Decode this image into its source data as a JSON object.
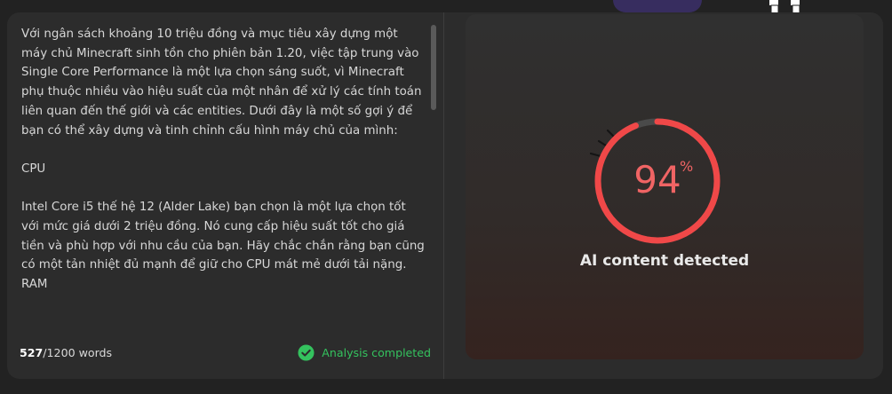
{
  "input_text": {
    "paragraphs": [
      "Với ngân sách khoảng 10 triệu đồng và mục tiêu xây dựng một máy chủ Minecraft sinh tồn cho phiên bản 1.20, việc tập trung vào Single Core Performance là một lựa chọn sáng suốt, vì Minecraft phụ thuộc nhiều vào hiệu suất của một nhân để xử lý các tính toán liên quan đến thế giới và các entities. Dưới đây là một số gợi ý để bạn có thể xây dựng và tinh chỉnh cấu hình máy chủ của mình:",
      "CPU",
      "Intel Core i5 thế hệ 12 (Alder Lake) bạn chọn là một lựa chọn tốt với mức giá dưới 2 triệu đồng. Nó cung cấp hiệu suất tốt cho giá tiền và phù hợp với nhu cầu của bạn. Hãy chắc chắn rằng bạn cũng có một tản nhiệt đủ mạnh để giữ cho CPU mát mẻ dưới tải nặng.",
      "RAM"
    ]
  },
  "word_count": {
    "current": "527",
    "limit_text": "/1200 words"
  },
  "status": {
    "label": "Analysis completed",
    "icon": "check-circle-icon",
    "color": "#34c25e"
  },
  "result": {
    "percent": 94,
    "percent_text": "94",
    "percent_sign": "%",
    "label": "AI content detected",
    "gauge_color": "#f04848",
    "track_color": "#4a4a4a"
  }
}
